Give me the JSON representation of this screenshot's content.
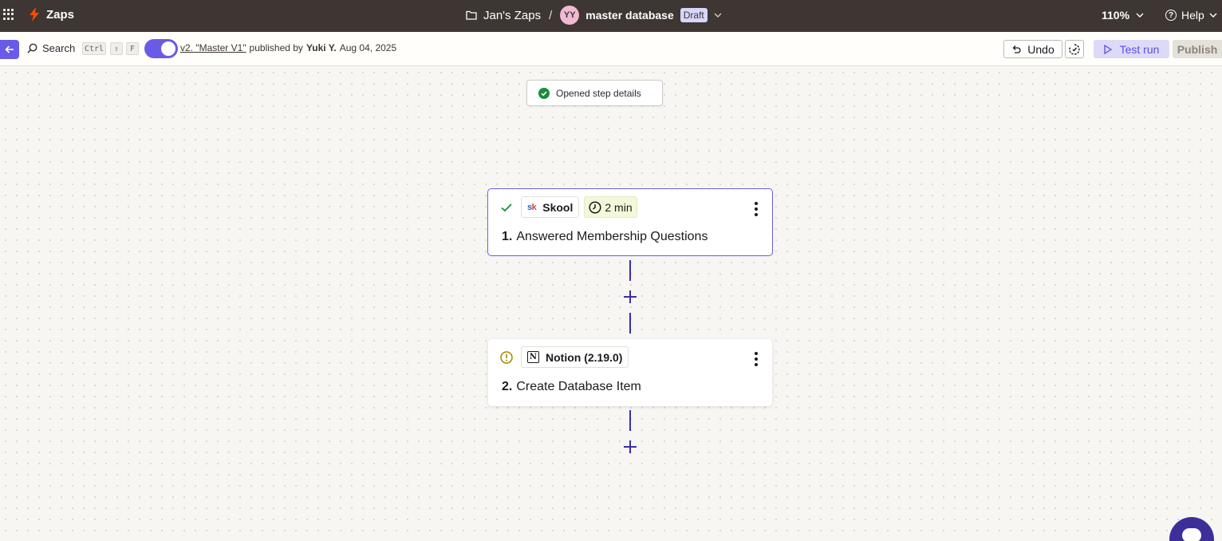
{
  "topbar": {
    "app_name": "Zaps",
    "breadcrumb_folder": "Jan's Zaps",
    "breadcrumb_sep": "/",
    "avatar_initials": "YY",
    "zap_name": "master database",
    "status_badge": "Draft",
    "zoom_level": "110%",
    "help_label": "Help"
  },
  "toolbar": {
    "search_label": "Search",
    "shortcut_keys": [
      "Ctrl",
      "⇧",
      "F"
    ],
    "version_link": "v2. \"Master V1\"",
    "published_by_text": "published by",
    "publisher": "Yuki Y.",
    "publish_date": "Aug 04, 2025",
    "undo_label": "Undo",
    "test_run_label": "Test run",
    "publish_label": "Publish"
  },
  "toast": {
    "message": "Opened step details"
  },
  "steps": [
    {
      "status": "success",
      "app": "Skool",
      "app_logo_text": [
        "s",
        "k"
      ],
      "duration": "2 min",
      "number": "1.",
      "title": "Answered Membership Questions"
    },
    {
      "status": "warning",
      "app": "Notion (2.19.0)",
      "app_logo_text": "N",
      "number": "2.",
      "title": "Create Database Item"
    }
  ],
  "colors": {
    "topbar_bg": "#3d3632",
    "accent": "#695be8",
    "success": "#1d8a3c",
    "warning": "#a38a00",
    "connector": "#3a2fa8"
  }
}
